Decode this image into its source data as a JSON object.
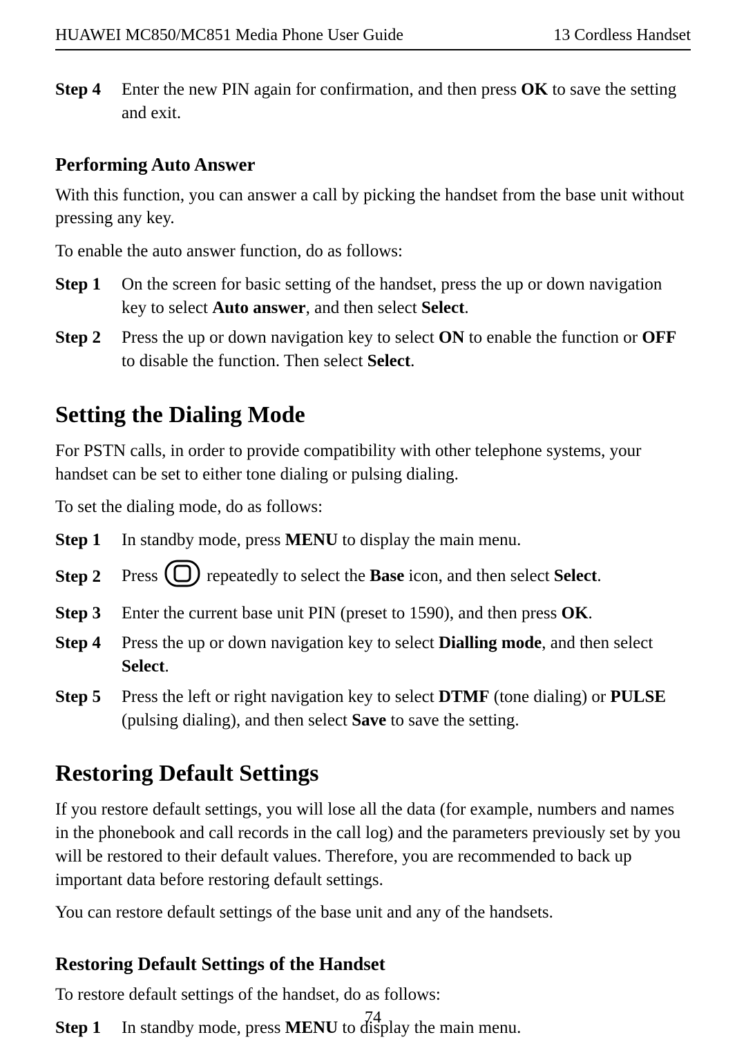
{
  "header": {
    "left": "HUAWEI MC850/MC851 Media Phone User Guide",
    "right": "13 Cordless Handset"
  },
  "intro_step": {
    "label": "Step 4",
    "t0": "Enter the new PIN again for confirmation, and then press ",
    "b0": "OK",
    "t1": " to save the setting and exit."
  },
  "sec_a": {
    "heading": "Performing Auto Answer",
    "p1": "With this function, you can answer a call by picking the handset from the base unit without pressing any key.",
    "p2": "To enable the auto answer function, do as follows:",
    "steps": [
      {
        "label": "Step 1",
        "t0": "On the screen for basic setting of the handset, press the up or down navigation key to select ",
        "b0": "Auto answer",
        "t1": ", and then select ",
        "b1": "Select",
        "t2": "."
      },
      {
        "label": "Step 2",
        "t0": "Press the up or down navigation key to select ",
        "b0": "ON",
        "t1": " to enable the function or ",
        "b1": "OFF",
        "t2": " to disable the function. Then select ",
        "b2": "Select",
        "t3": "."
      }
    ]
  },
  "sec_b": {
    "heading": "Setting the Dialing Mode",
    "p1": "For PSTN calls, in order to provide compatibility with other telephone systems, your handset can be set to either tone dialing or pulsing dialing.",
    "p2": "To set the dialing mode, do as follows:",
    "steps": [
      {
        "label": "Step 1",
        "t0": "In standby mode, press ",
        "b0": "MENU",
        "t1": " to display the main menu."
      },
      {
        "label": "Step 2",
        "t0": "Press ",
        "t1": " repeatedly to select the ",
        "b0": "Base",
        "t2": " icon, and then select ",
        "b1": "Select",
        "t3": "."
      },
      {
        "label": "Step 3",
        "t0": "Enter the current base unit PIN (preset to 1590), and then press ",
        "b0": "OK",
        "t1": "."
      },
      {
        "label": "Step 4",
        "t0": "Press the up or down navigation key to select ",
        "b0": "Dialling mode",
        "t1": ", and then select ",
        "b1": "Select",
        "t2": "."
      },
      {
        "label": "Step 5",
        "t0": "Press the left or right navigation key to select ",
        "b0": "DTMF",
        "t1": " (tone dialing) or ",
        "b1": "PULSE",
        "t2": " (pulsing dialing), and then select ",
        "b2": "Save",
        "t3": " to save the setting."
      }
    ]
  },
  "sec_c": {
    "heading": "Restoring Default Settings",
    "p1": "If you restore default settings, you will lose all the data (for example, numbers and names in the phonebook and call records in the call log) and the parameters previously set by you will be restored to their default values. Therefore, you are recommended to back up important data before restoring default settings.",
    "p2": "You can restore default settings of the base unit and any of the handsets.",
    "sub": {
      "heading": "Restoring Default Settings of the Handset",
      "p1": "To restore default settings of the handset, do as follows:",
      "step": {
        "label": "Step 1",
        "t0": "In standby mode, press ",
        "b0": "MENU",
        "t1": " to display the main menu."
      }
    }
  },
  "page_number": "74"
}
